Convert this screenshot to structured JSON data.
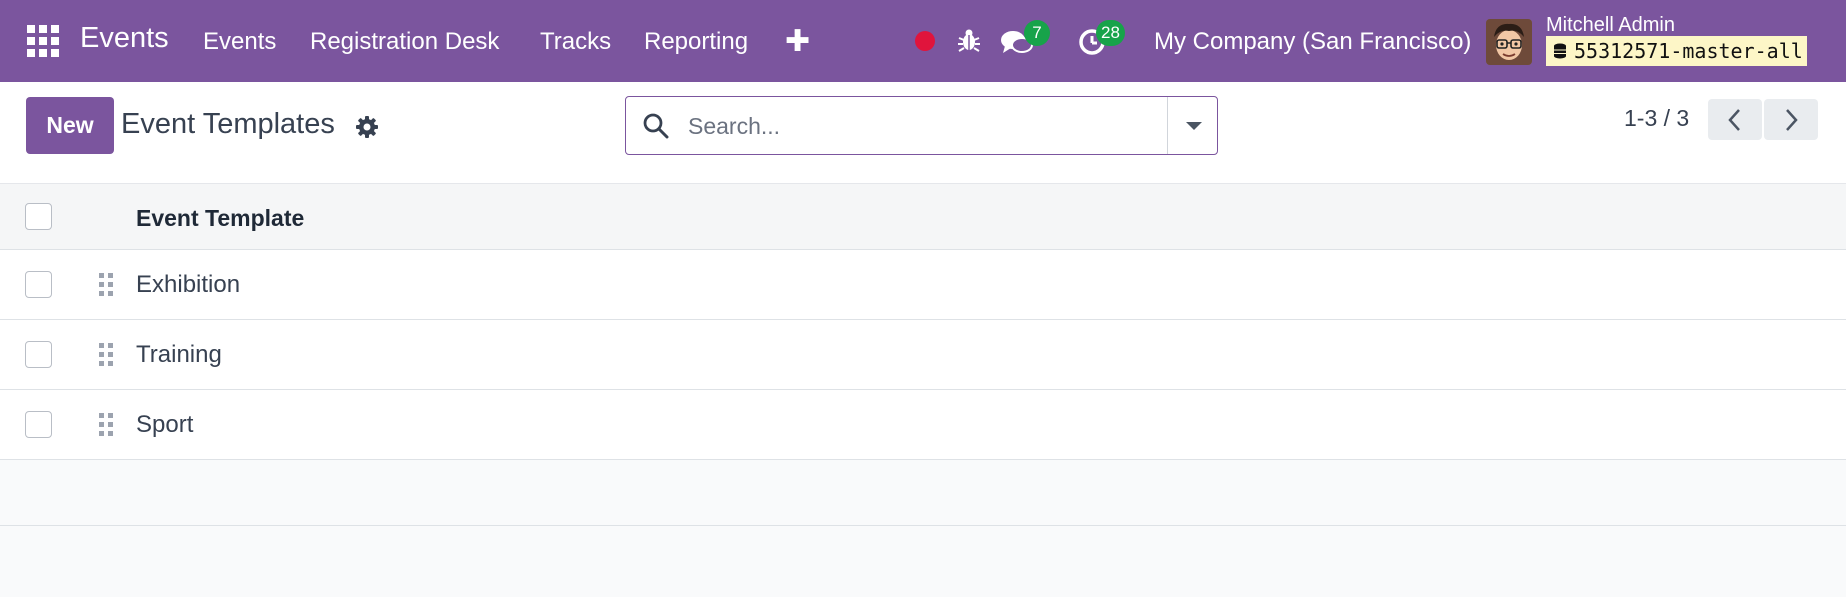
{
  "navbar": {
    "brand": "Events",
    "menus": [
      "Events",
      "Registration Desk",
      "Tracks",
      "Reporting"
    ],
    "messages_count": "7",
    "activities_count": "28",
    "company": "My Company (San Francisco)",
    "user_name": "Mitchell Admin",
    "database": "55312571-master-all",
    "accent_color": "#7b559e",
    "badge_color": "#17a34a",
    "record_dot_color": "#e0143c"
  },
  "control_panel": {
    "new_label": "New",
    "title": "Event Templates",
    "search_placeholder": "Search...",
    "pager": "1-3 / 3"
  },
  "list": {
    "column_header": "Event Template",
    "rows": [
      {
        "name": "Exhibition"
      },
      {
        "name": "Training"
      },
      {
        "name": "Sport"
      }
    ]
  }
}
